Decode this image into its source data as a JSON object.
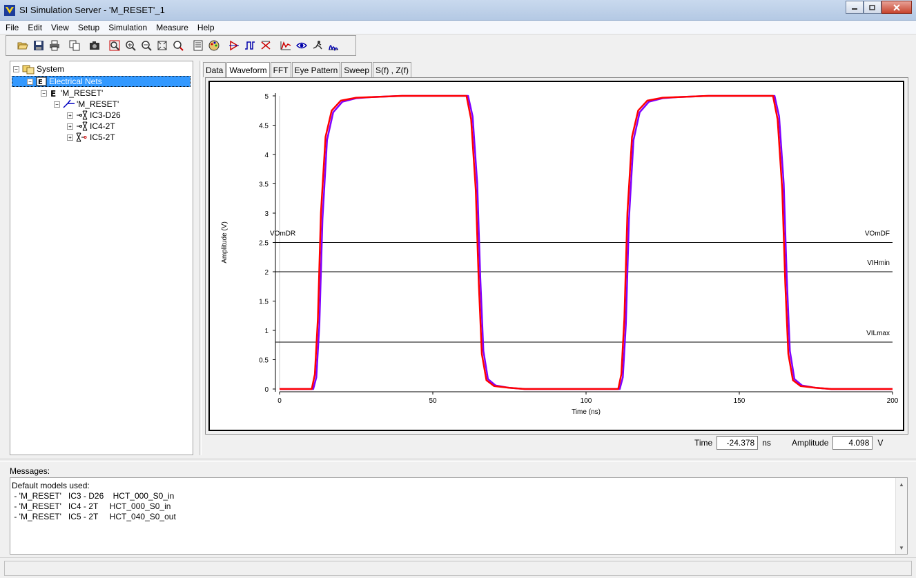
{
  "window": {
    "title": "SI Simulation Server - 'M_RESET'_1"
  },
  "menu": [
    "File",
    "Edit",
    "View",
    "Setup",
    "Simulation",
    "Measure",
    "Help"
  ],
  "toolbar": {
    "buttons": [
      "open-icon",
      "save-icon",
      "print-icon",
      "copy-icon",
      "camera-icon",
      "zoom-fit-icon",
      "zoom-in-icon",
      "zoom-out-icon",
      "zoom-extents-icon",
      "zoom-area-icon",
      "sheet-icon",
      "palette-icon",
      "probe-icon",
      "waveform-icon",
      "crosstalk-icon",
      "signal-icon",
      "eye-icon",
      "runner-icon",
      "spectrum-icon"
    ]
  },
  "tree": {
    "system": "System",
    "electrical_nets": "Electrical Nets",
    "net": "'M_RESET'",
    "subnet": "'M_RESET'",
    "components": [
      "IC3-D26",
      "IC4-2T",
      "IC5-2T"
    ]
  },
  "tabs": [
    "Data",
    "Waveform",
    "FFT",
    "Eye Pattern",
    "Sweep",
    "S(f) , Z(f)"
  ],
  "active_tab": "Waveform",
  "chart_data": {
    "type": "line",
    "xlabel": "Time (ns)",
    "ylabel": "Amplitude (V)",
    "xlim": [
      0,
      200
    ],
    "ylim": [
      0,
      5
    ],
    "xticks": [
      0,
      50,
      100,
      150,
      200
    ],
    "yticks": [
      0,
      0.5,
      1,
      1.5,
      2,
      2.5,
      3,
      3.5,
      4,
      4.5,
      5
    ],
    "grid": false,
    "series": [
      {
        "color": "#ff0000",
        "x": [
          0,
          10.5,
          11.5,
          12.5,
          13.5,
          15,
          17,
          20,
          25,
          30,
          40,
          61,
          62.5,
          64,
          65,
          66,
          67.5,
          70,
          75,
          80,
          110.5,
          111.5,
          112.5,
          113.5,
          115,
          117,
          120,
          125,
          130,
          140,
          161,
          162.5,
          164,
          165,
          166,
          167.5,
          170,
          175,
          180,
          200
        ],
        "values": [
          0,
          0,
          0.25,
          1.2,
          3.0,
          4.3,
          4.75,
          4.92,
          4.97,
          4.98,
          5.0,
          5.0,
          4.6,
          3.4,
          1.8,
          0.6,
          0.15,
          0.05,
          0.02,
          0.0,
          0,
          0.25,
          1.2,
          3.0,
          4.3,
          4.75,
          4.92,
          4.97,
          4.98,
          5.0,
          5.0,
          4.6,
          3.4,
          1.8,
          0.6,
          0.15,
          0.05,
          0.02,
          0.0,
          0
        ]
      },
      {
        "color": "#8000ff",
        "x": [
          0,
          11,
          12,
          13,
          14,
          15.5,
          17.5,
          20.5,
          25,
          30,
          40,
          61.5,
          63,
          64.5,
          65.5,
          66.5,
          68,
          70.5,
          75,
          80,
          111,
          112,
          113,
          114,
          115.5,
          117.5,
          120.5,
          125,
          130,
          140,
          161.5,
          163,
          164.5,
          165.5,
          166.5,
          168,
          170.5,
          175,
          180,
          200
        ],
        "values": [
          0,
          0,
          0.2,
          1.1,
          2.9,
          4.25,
          4.72,
          4.9,
          4.96,
          4.98,
          5.0,
          5.0,
          4.65,
          3.5,
          1.9,
          0.65,
          0.17,
          0.06,
          0.02,
          0.0,
          0,
          0.2,
          1.1,
          2.9,
          4.25,
          4.72,
          4.9,
          4.96,
          4.98,
          5.0,
          5.0,
          4.65,
          3.5,
          1.9,
          0.65,
          0.17,
          0.06,
          0.02,
          0.0,
          0
        ]
      }
    ],
    "thresholds": [
      {
        "value": 2.5,
        "label_left": "VOmDR",
        "label_right": "VOmDF"
      },
      {
        "value": 2.0,
        "label_left": "",
        "label_right": "VIHmin"
      },
      {
        "value": 0.8,
        "label_left": "",
        "label_right": "VILmax"
      }
    ]
  },
  "readout": {
    "time_label": "Time",
    "time_value": "-24.378",
    "time_unit": "ns",
    "amp_label": "Amplitude",
    "amp_value": "4.098",
    "amp_unit": "V"
  },
  "messages": {
    "label": "Messages:",
    "lines": [
      "Default models used:",
      " - 'M_RESET'   IC3 - D26    HCT_000_S0_in",
      " - 'M_RESET'   IC4 - 2T     HCT_000_S0_in",
      " - 'M_RESET'   IC5 - 2T     HCT_040_S0_out"
    ]
  }
}
